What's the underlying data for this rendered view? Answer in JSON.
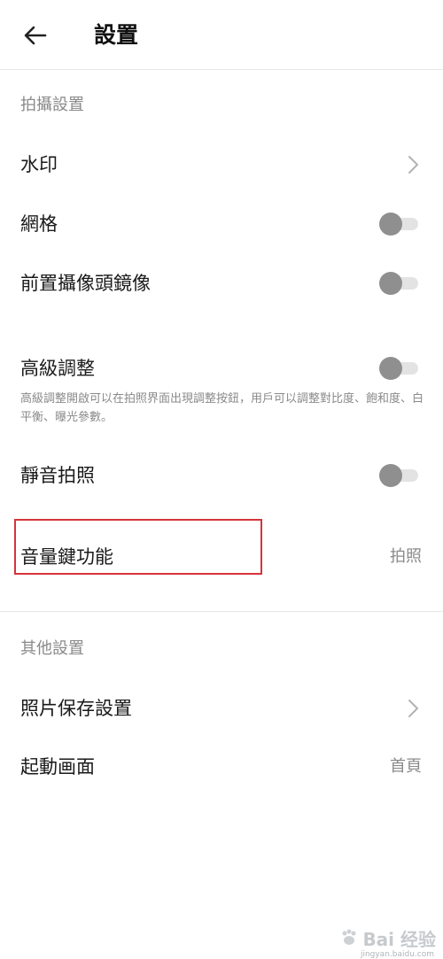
{
  "header": {
    "title": "設置",
    "back_icon": "arrow-left-icon"
  },
  "sections": {
    "shooting": {
      "title": "拍攝設置",
      "watermark_label": "水印",
      "grid_label": "網格",
      "grid_on": false,
      "front_mirror_label": "前置攝像頭鏡像",
      "front_mirror_on": false,
      "advanced_label": "高級調整",
      "advanced_on": false,
      "advanced_desc": "高級調整開啟可以在拍照界面出現調整按鈕，用戶可以調整對比度、飽和度、白平衡、曝光參數。",
      "silent_label": "靜音拍照",
      "silent_on": false,
      "volume_key_label": "音量鍵功能",
      "volume_key_value": "拍照"
    },
    "other": {
      "title": "其他設置",
      "photo_save_label": "照片保存設置",
      "startup_label": "起動画面",
      "startup_value": "首頁"
    }
  },
  "watermark_overlay": {
    "text": "Bai 经验",
    "sub": "jingyan.baidu.com"
  },
  "colors": {
    "highlight": "#d6343b",
    "toggle_knob": "#8f8f8f",
    "toggle_track": "#e3e3e3",
    "secondary_text": "#8a8a8a"
  }
}
